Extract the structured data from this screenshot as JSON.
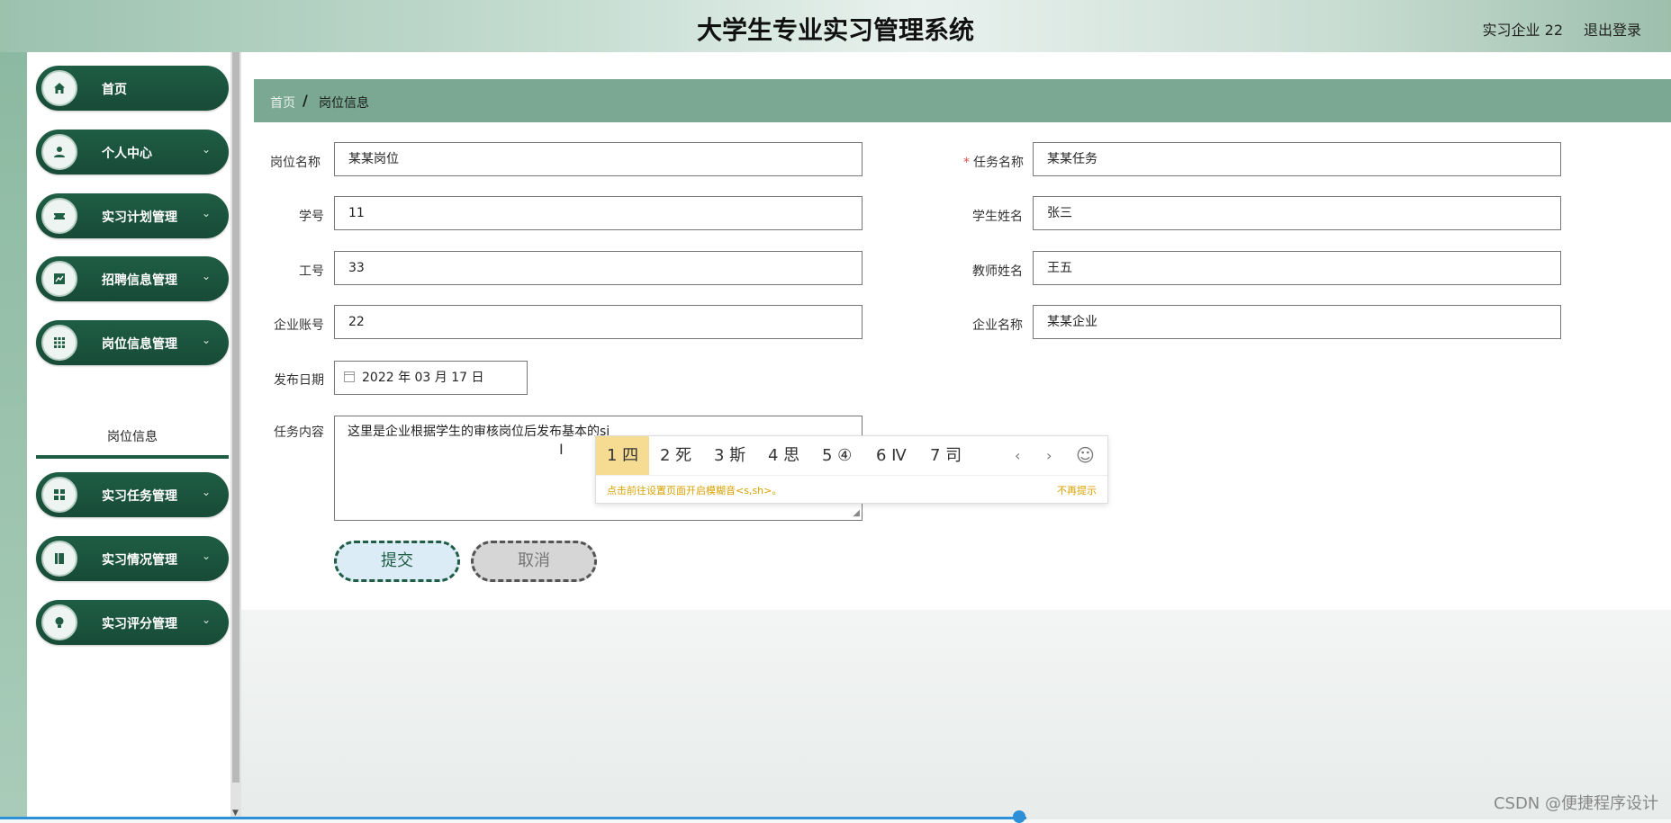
{
  "header": {
    "title": "大学生专业实习管理系统",
    "user": "实习企业 22",
    "logout": "退出登录"
  },
  "sidebar": {
    "items": [
      {
        "label": "首页",
        "icon": "home-icon"
      },
      {
        "label": "个人中心",
        "icon": "person-icon"
      },
      {
        "label": "实习计划管理",
        "icon": "ticket-icon"
      },
      {
        "label": "招聘信息管理",
        "icon": "chart-icon"
      },
      {
        "label": "岗位信息管理",
        "icon": "grid-icon"
      },
      {
        "label": "实习任务管理",
        "icon": "apps-icon"
      },
      {
        "label": "实习情况管理",
        "icon": "book-icon"
      },
      {
        "label": "实习评分管理",
        "icon": "bulb-icon"
      }
    ],
    "sub_item": "岗位信息"
  },
  "breadcrumb": {
    "home": "首页",
    "separator": "/",
    "current": "岗位信息"
  },
  "form": {
    "job_name": {
      "label": "岗位名称",
      "value": "某某岗位"
    },
    "task_name": {
      "label": "任务名称",
      "value": "某某任务",
      "required_mark": "*"
    },
    "student_no": {
      "label": "学号",
      "value": "11"
    },
    "student_name": {
      "label": "学生姓名",
      "value": "张三"
    },
    "staff_no": {
      "label": "工号",
      "value": "33"
    },
    "teacher_name": {
      "label": "教师姓名",
      "value": "王五"
    },
    "company_account": {
      "label": "企业账号",
      "value": "22"
    },
    "company_name": {
      "label": "企业名称",
      "value": "某某企业"
    },
    "publish_date": {
      "label": "发布日期",
      "value": "2022 年 03 月 17 日"
    },
    "task_content": {
      "label": "任务内容",
      "value": "这里是企业根据学生的审核岗位后发布基本的si"
    }
  },
  "ime": {
    "candidates": [
      "1 四",
      "2 死",
      "3 斯",
      "4 思",
      "5 ④",
      "6 Ⅳ",
      "7 司"
    ],
    "prev": "‹",
    "next": "›",
    "emoji": "☺",
    "tip": "点击前往设置页面开启模糊音<s,sh>。",
    "dismiss": "不再提示"
  },
  "buttons": {
    "submit": "提交",
    "cancel": "取消"
  },
  "watermark": "CSDN @便捷程序设计",
  "colors": {
    "primary": "#1f5d45",
    "breadcrumb_bg": "#7aa892",
    "ime_highlight": "#f6dc93"
  }
}
